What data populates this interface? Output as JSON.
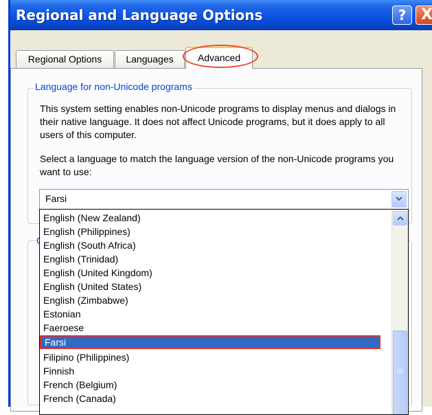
{
  "window": {
    "title": "Regional and Language Options",
    "help_label": "?",
    "close_label": "X"
  },
  "tabs": [
    {
      "label": "Regional Options",
      "active": false
    },
    {
      "label": "Languages",
      "active": false
    },
    {
      "label": "Advanced",
      "active": true
    }
  ],
  "group": {
    "caption": "Language for non-Unicode programs",
    "description": "This system setting enables non-Unicode programs to display menus and dialogs in their native language. It does not affect Unicode programs, but it does apply to all users of this computer.",
    "instruction": "Select a language to match the language version of the non-Unicode programs you want to use:"
  },
  "group2": {
    "caption_stub": "C"
  },
  "combo": {
    "value": "Farsi",
    "arrow_icon": "chevron-down-icon"
  },
  "dropdown": {
    "options": [
      "English (New Zealand)",
      "English (Philippines)",
      "English (South Africa)",
      "English (Trinidad)",
      "English (United Kingdom)",
      "English (United States)",
      "English (Zimbabwe)",
      "Estonian",
      "Faeroese",
      "Farsi",
      "Filipino (Philippines)",
      "Finnish",
      "French (Belgium)",
      "French (Canada)"
    ],
    "selected": "Farsi"
  },
  "colors": {
    "titlebar": "#0a54e3",
    "selection": "#316ac5",
    "annotation": "#e03030",
    "caption_text": "#0046d5"
  }
}
